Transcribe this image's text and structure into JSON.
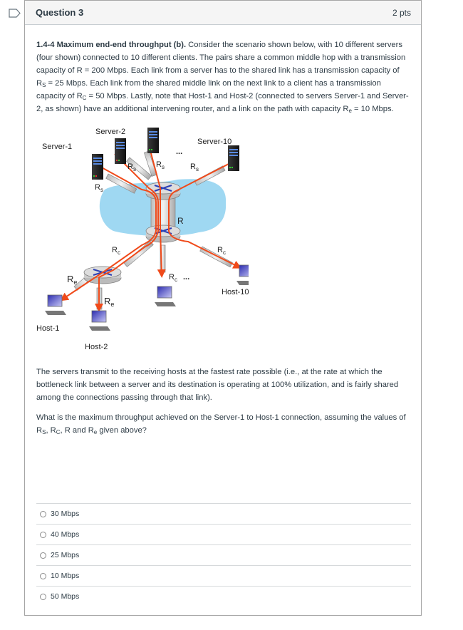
{
  "question": {
    "title": "Question 3",
    "points": "2 pts",
    "flag_icon": "bookmark-flag-icon",
    "intro": {
      "heading": "1.4-4 Maximum end-end throughput (b).",
      "t1": " Consider the scenario shown below, with 10 different servers (four shown) connected to 10 different clients. The pairs share a common middle hop with a transmission capacity of R = 200 Mbps. Each link from a server has to the shared link has a transmission capacity of R",
      "s_sub": "S",
      "t2": " = 25 Mbps. Each link from the shared middle link on the next link to a client has a transmission capacity of R",
      "c_sub": "C",
      "t3": " = 50 Mbps.  Lastly, note that Host-1 and Host-2 (connected to servers Server-1 and Server-2, as shown)  have an additional intervening router, and a  link on the path with capacity R",
      "e_sub": "e",
      "t4": " = 10 Mbps."
    },
    "para2": "The servers  transmit to the receiving hosts at the fastest rate possible (i.e., at the rate at which the bottleneck link between a server and its destination is operating at 100% utilization, and is fairly shared among the connections passing through that link).",
    "para3": {
      "t1": "What is the maximum throughput achieved on the Server-1 to Host-1 connection, assuming the values of R",
      "s_sub": "S",
      "t2": ", R",
      "c_sub": "C",
      "t3": ", R and R",
      "e_sub": "e",
      "t4": " given above?"
    },
    "answers": [
      {
        "label": "30 Mbps",
        "selected": false
      },
      {
        "label": "40 Mbps",
        "selected": false
      },
      {
        "label": "25 Mbps",
        "selected": false
      },
      {
        "label": "10 Mbps",
        "selected": false
      },
      {
        "label": "50 Mbps",
        "selected": false
      }
    ]
  },
  "diagram": {
    "servers": [
      "Server-1",
      "Server-2",
      "Server-10"
    ],
    "hosts": [
      "Host-1",
      "Host-2",
      "Host-10"
    ],
    "link_labels": {
      "rs": "R",
      "rs_sub": "s",
      "rc": "R",
      "rc_sub": "c",
      "re": "R",
      "re_sub": "e",
      "r": "R"
    },
    "ellipsis": "...",
    "colors": {
      "cloud": "#9fd8f2",
      "flow": "#f04a1a",
      "router": "#d4d4d4",
      "screen": "#5a5ad0"
    }
  }
}
